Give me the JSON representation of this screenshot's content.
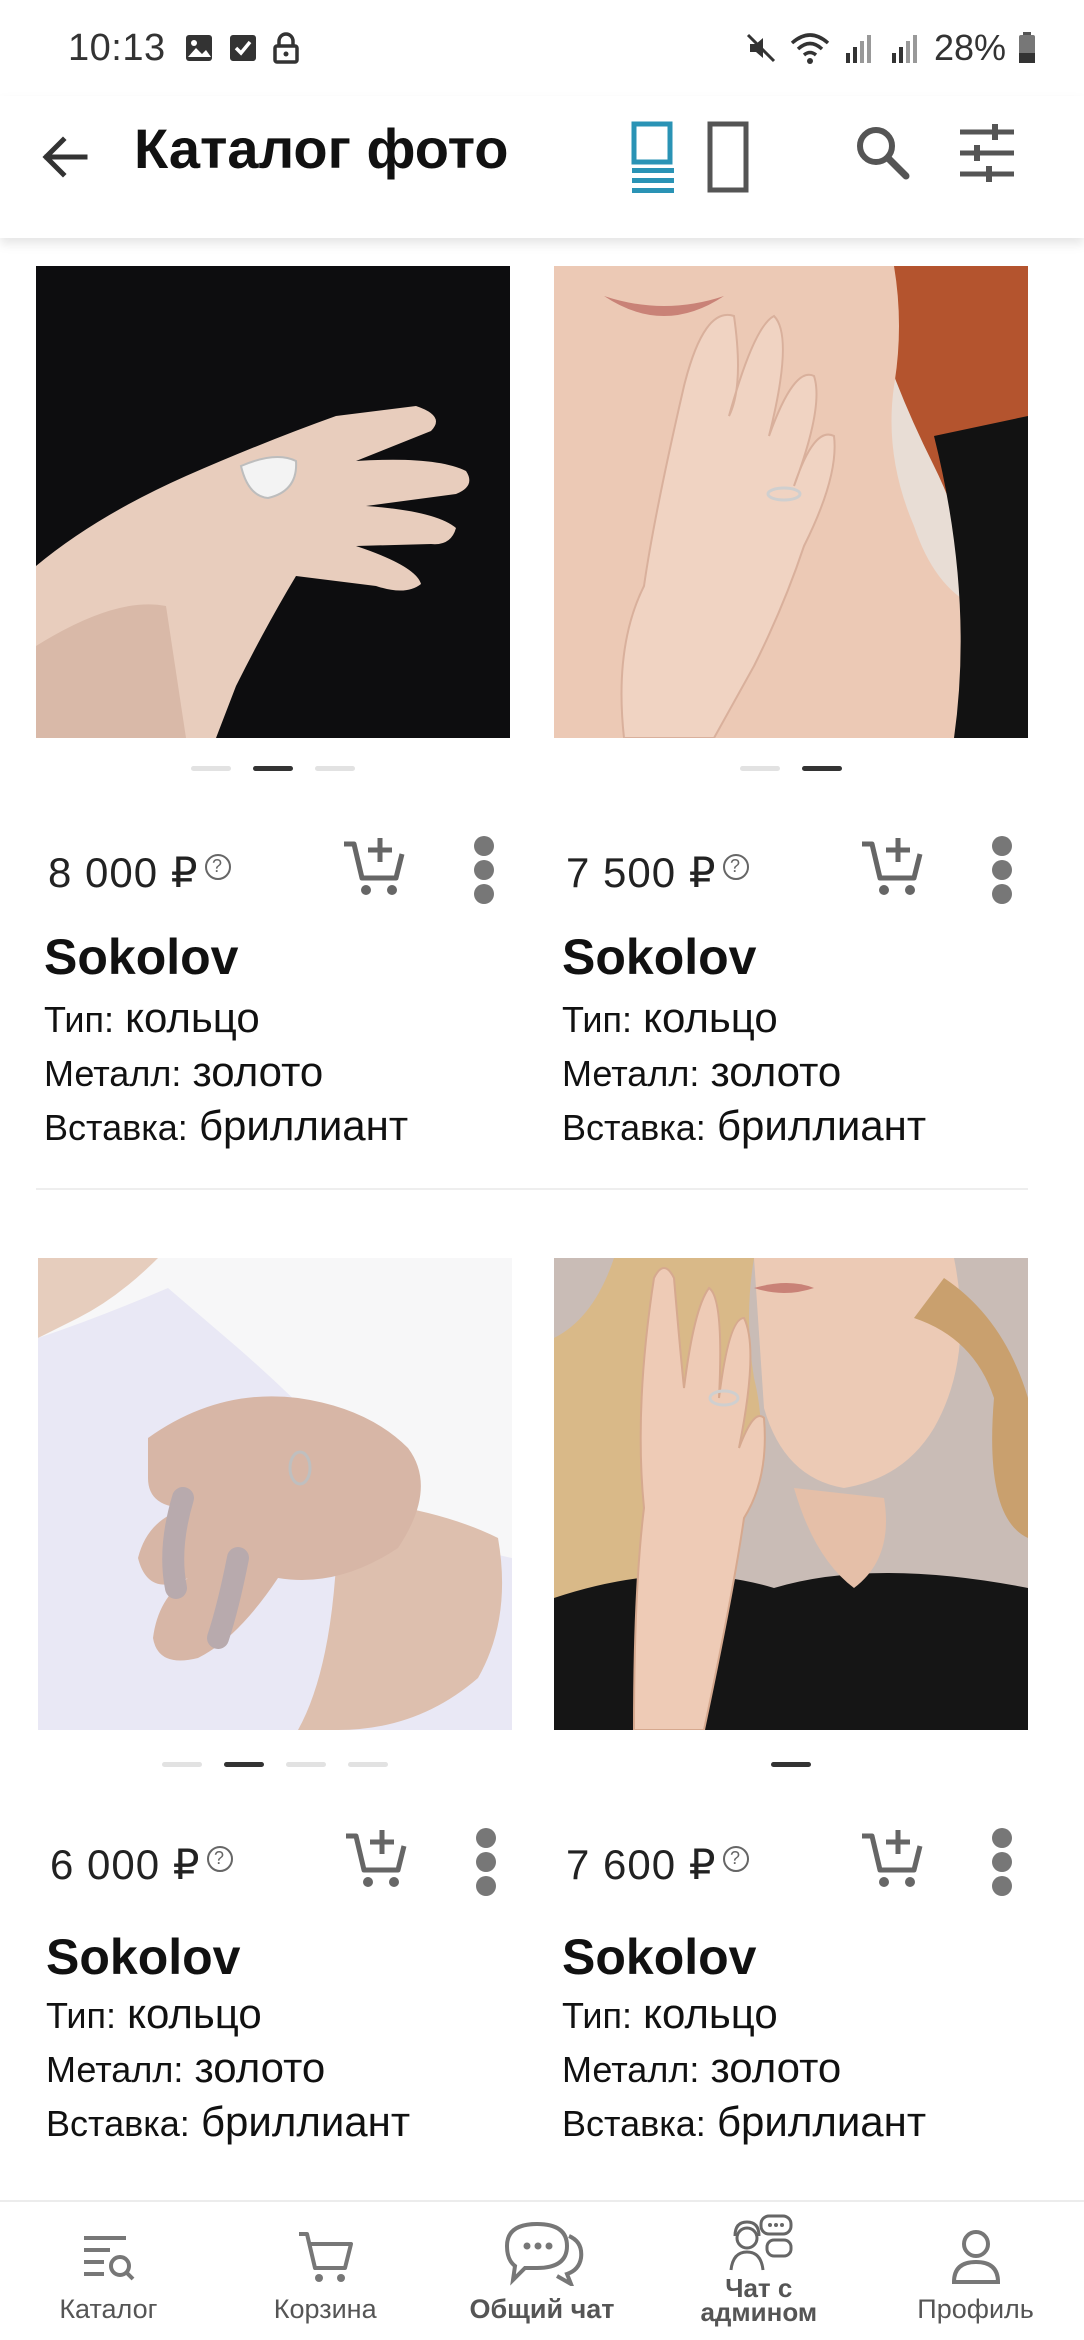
{
  "status_bar": {
    "time": "10:13",
    "battery": "28%"
  },
  "app_bar": {
    "title": "Каталог фото",
    "accent_color": "#2a93b5"
  },
  "products": [
    {
      "price": "8 000 ₽",
      "price_help": "?",
      "brand": "Sokolov",
      "type_label": "Тип:",
      "type_value": "кольцо",
      "metal_label": "Металл:",
      "metal_value": "золото",
      "insert_label": "Вставка:",
      "insert_value": "бриллиант",
      "photo_count": 3,
      "photo_active_index": 2
    },
    {
      "price": "7 500 ₽",
      "price_help": "?",
      "brand": "Sokolov",
      "type_label": "Тип:",
      "type_value": "кольцо",
      "metal_label": "Металл:",
      "metal_value": "золото",
      "insert_label": "Вставка:",
      "insert_value": "бриллиант",
      "photo_count": 2,
      "photo_active_index": 2
    },
    {
      "price": "6 000 ₽",
      "price_help": "?",
      "brand": "Sokolov",
      "type_label": "Тип:",
      "type_value": "кольцо",
      "metal_label": "Металл:",
      "metal_value": "золото",
      "insert_label": "Вставка:",
      "insert_value": "бриллиант",
      "photo_count": 4,
      "photo_active_index": 2
    },
    {
      "price": "7 600 ₽",
      "price_help": "?",
      "brand": "Sokolov",
      "type_label": "Тип:",
      "type_value": "кольцо",
      "metal_label": "Металл:",
      "metal_value": "золото",
      "insert_label": "Вставка:",
      "insert_value": "бриллиант",
      "photo_count": 1,
      "photo_active_index": 1
    }
  ],
  "bottom_nav": {
    "catalog": "Каталог",
    "cart": "Корзина",
    "general_chat": "Общий чат",
    "admin_chat_line1": "Чат с",
    "admin_chat_line2": "админом",
    "profile": "Профиль"
  }
}
